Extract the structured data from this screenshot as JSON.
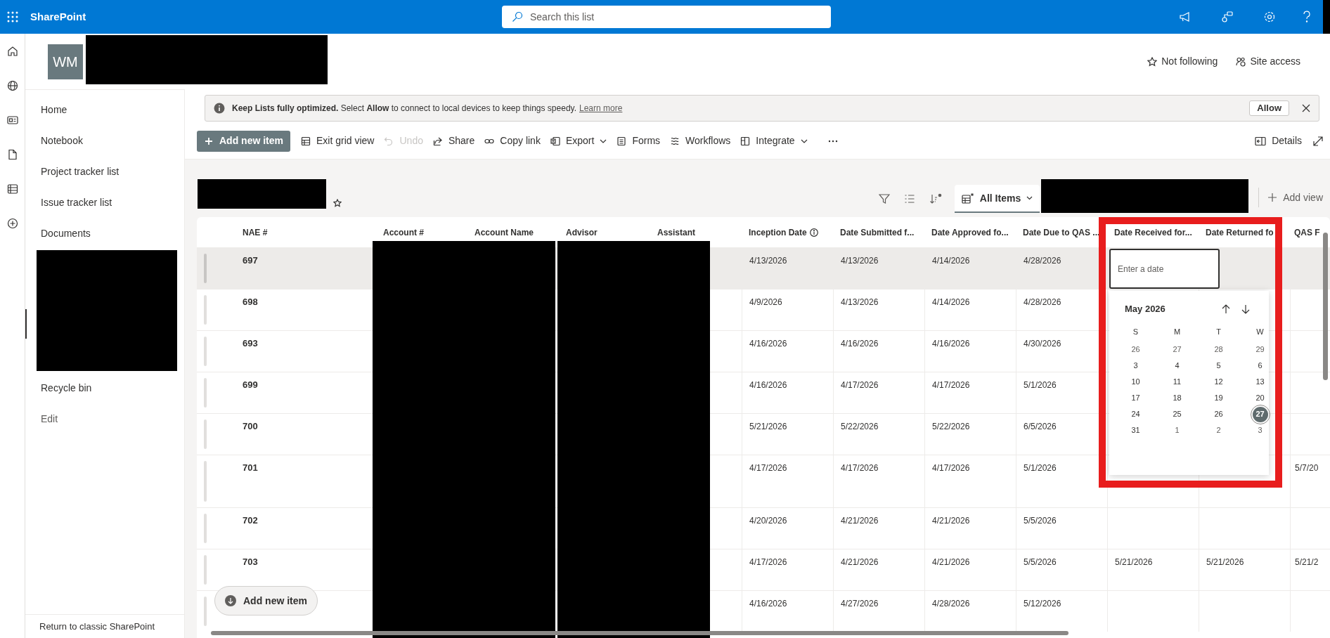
{
  "top_bar": {
    "app_name": "SharePoint",
    "search": {
      "placeholder": "Search this list"
    }
  },
  "site": {
    "initials": "WM",
    "follow": "Not following",
    "access": "Site access"
  },
  "nav": [
    {
      "label": "Home",
      "kind": "page"
    },
    {
      "label": "Notebook",
      "kind": "page"
    },
    {
      "label": "Project tracker list",
      "kind": "page"
    },
    {
      "label": "Issue tracker list",
      "kind": "page"
    },
    {
      "label": "Documents",
      "kind": "page"
    },
    {
      "label": "Recycle bin",
      "kind": "page"
    },
    {
      "label": "Edit",
      "kind": "action"
    }
  ],
  "nav_footer": "Return to classic SharePoint",
  "banner": {
    "message": "**Keep Lists fully optimized.** Select **Allow** to connect to local devices to keep things speedy.",
    "link": "Learn more",
    "button": "Allow"
  },
  "commands": [
    {
      "label": "Add new item",
      "kind": "primary",
      "disabled": false,
      "menu": false
    },
    {
      "label": "Exit grid view",
      "kind": "command",
      "disabled": false,
      "menu": false
    },
    {
      "label": "Undo",
      "kind": "command",
      "disabled": true,
      "menu": false
    },
    {
      "label": "Share",
      "kind": "command",
      "disabled": false,
      "menu": false
    },
    {
      "label": "Copy link",
      "kind": "command",
      "disabled": false,
      "menu": false
    },
    {
      "label": "Export",
      "kind": "command",
      "disabled": false,
      "menu": true
    },
    {
      "label": "Forms",
      "kind": "command",
      "disabled": false,
      "menu": false
    },
    {
      "label": "Workflows",
      "kind": "command",
      "disabled": false,
      "menu": false
    },
    {
      "label": "Integrate",
      "kind": "command",
      "disabled": false,
      "menu": true
    },
    {
      "kind": "overflow"
    }
  ],
  "details_button": "Details",
  "views": {
    "tabs": [
      {
        "label": "All Items",
        "selected": true
      }
    ],
    "add_view": "Add view"
  },
  "table": {
    "columns": [
      {
        "label": "NAE #",
        "info": false
      },
      {
        "label": "Account #",
        "info": false
      },
      {
        "label": "Account Name",
        "info": false
      },
      {
        "label": "Advisor",
        "info": false
      },
      {
        "label": "Assistant",
        "info": false
      },
      {
        "label": "Inception Date",
        "info": true
      },
      {
        "label": "Date Submitted f...",
        "info": false
      },
      {
        "label": "Date Approved fo...",
        "info": false
      },
      {
        "label": "Date Due to QAS ...",
        "info": false
      },
      {
        "label": "Date Received for...",
        "info": false
      },
      {
        "label": "Date Returned fo",
        "info": false
      },
      {
        "label": "QAS F",
        "info": false
      }
    ],
    "rows": [
      {
        "selected": true,
        "tall": false,
        "nae": "697",
        "inception": "4/13/2026",
        "submitted": "4/13/2026",
        "approved": "4/14/2026",
        "due": "4/28/2026"
      },
      {
        "selected": false,
        "tall": false,
        "nae": "698",
        "inception": "4/9/2026",
        "submitted": "4/13/2026",
        "approved": "4/14/2026",
        "due": "4/28/2026"
      },
      {
        "selected": false,
        "tall": false,
        "nae": "693",
        "inception": "4/16/2026",
        "submitted": "4/16/2026",
        "approved": "4/16/2026",
        "due": "4/30/2026"
      },
      {
        "selected": false,
        "tall": false,
        "nae": "699",
        "inception": "4/16/2026",
        "submitted": "4/17/2026",
        "approved": "4/17/2026",
        "due": "5/1/2026"
      },
      {
        "selected": false,
        "tall": false,
        "nae": "700",
        "inception": "5/21/2026",
        "submitted": "5/22/2026",
        "approved": "5/22/2026",
        "due": "6/5/2026"
      },
      {
        "selected": false,
        "tall": true,
        "nae": "701",
        "inception": "4/17/2026",
        "submitted": "4/17/2026",
        "approved": "4/17/2026",
        "due": "5/1/2026",
        "qas": "5/7/20"
      },
      {
        "selected": false,
        "tall": false,
        "nae": "702",
        "inception": "4/20/2026",
        "submitted": "4/21/2026",
        "approved": "4/21/2026",
        "due": "5/5/2026"
      },
      {
        "selected": false,
        "tall": false,
        "nae": "703",
        "inception": "4/17/2026",
        "submitted": "4/21/2026",
        "approved": "4/21/2026",
        "due": "5/5/2026",
        "received": "5/21/2026",
        "returned": "5/21/2026",
        "qas": "5/21/2"
      },
      {
        "selected": false,
        "tall": false,
        "inception": "4/16/2026",
        "submitted": "4/27/2026",
        "approved": "4/28/2026",
        "due": "5/12/2026"
      }
    ]
  },
  "date_picker": {
    "placeholder": "Enter a date",
    "month": "May 2026",
    "weekdays": [
      "S",
      "M",
      "T",
      "W"
    ],
    "weeks": [
      [
        {
          "day": "26",
          "outside": true,
          "selected": false
        },
        {
          "day": "27",
          "outside": true,
          "selected": false
        },
        {
          "day": "28",
          "outside": true,
          "selected": false
        },
        {
          "day": "29",
          "outside": true,
          "selected": false
        }
      ],
      [
        {
          "day": "3",
          "outside": false,
          "selected": false
        },
        {
          "day": "4",
          "outside": false,
          "selected": false
        },
        {
          "day": "5",
          "outside": false,
          "selected": false
        },
        {
          "day": "6",
          "outside": false,
          "selected": false
        }
      ],
      [
        {
          "day": "10",
          "outside": false,
          "selected": false
        },
        {
          "day": "11",
          "outside": false,
          "selected": false
        },
        {
          "day": "12",
          "outside": false,
          "selected": false
        },
        {
          "day": "13",
          "outside": false,
          "selected": false
        }
      ],
      [
        {
          "day": "17",
          "outside": false,
          "selected": false
        },
        {
          "day": "18",
          "outside": false,
          "selected": false
        },
        {
          "day": "19",
          "outside": false,
          "selected": false
        },
        {
          "day": "20",
          "outside": false,
          "selected": false
        }
      ],
      [
        {
          "day": "24",
          "outside": false,
          "selected": false
        },
        {
          "day": "25",
          "outside": false,
          "selected": false
        },
        {
          "day": "26",
          "outside": false,
          "selected": false
        },
        {
          "day": "27",
          "outside": false,
          "selected": true
        }
      ],
      [
        {
          "day": "31",
          "outside": false,
          "selected": false
        },
        {
          "day": "1",
          "outside": true,
          "selected": false
        },
        {
          "day": "2",
          "outside": true,
          "selected": false
        },
        {
          "day": "3",
          "outside": true,
          "selected": false
        }
      ]
    ]
  },
  "floating_button": "Add new item"
}
